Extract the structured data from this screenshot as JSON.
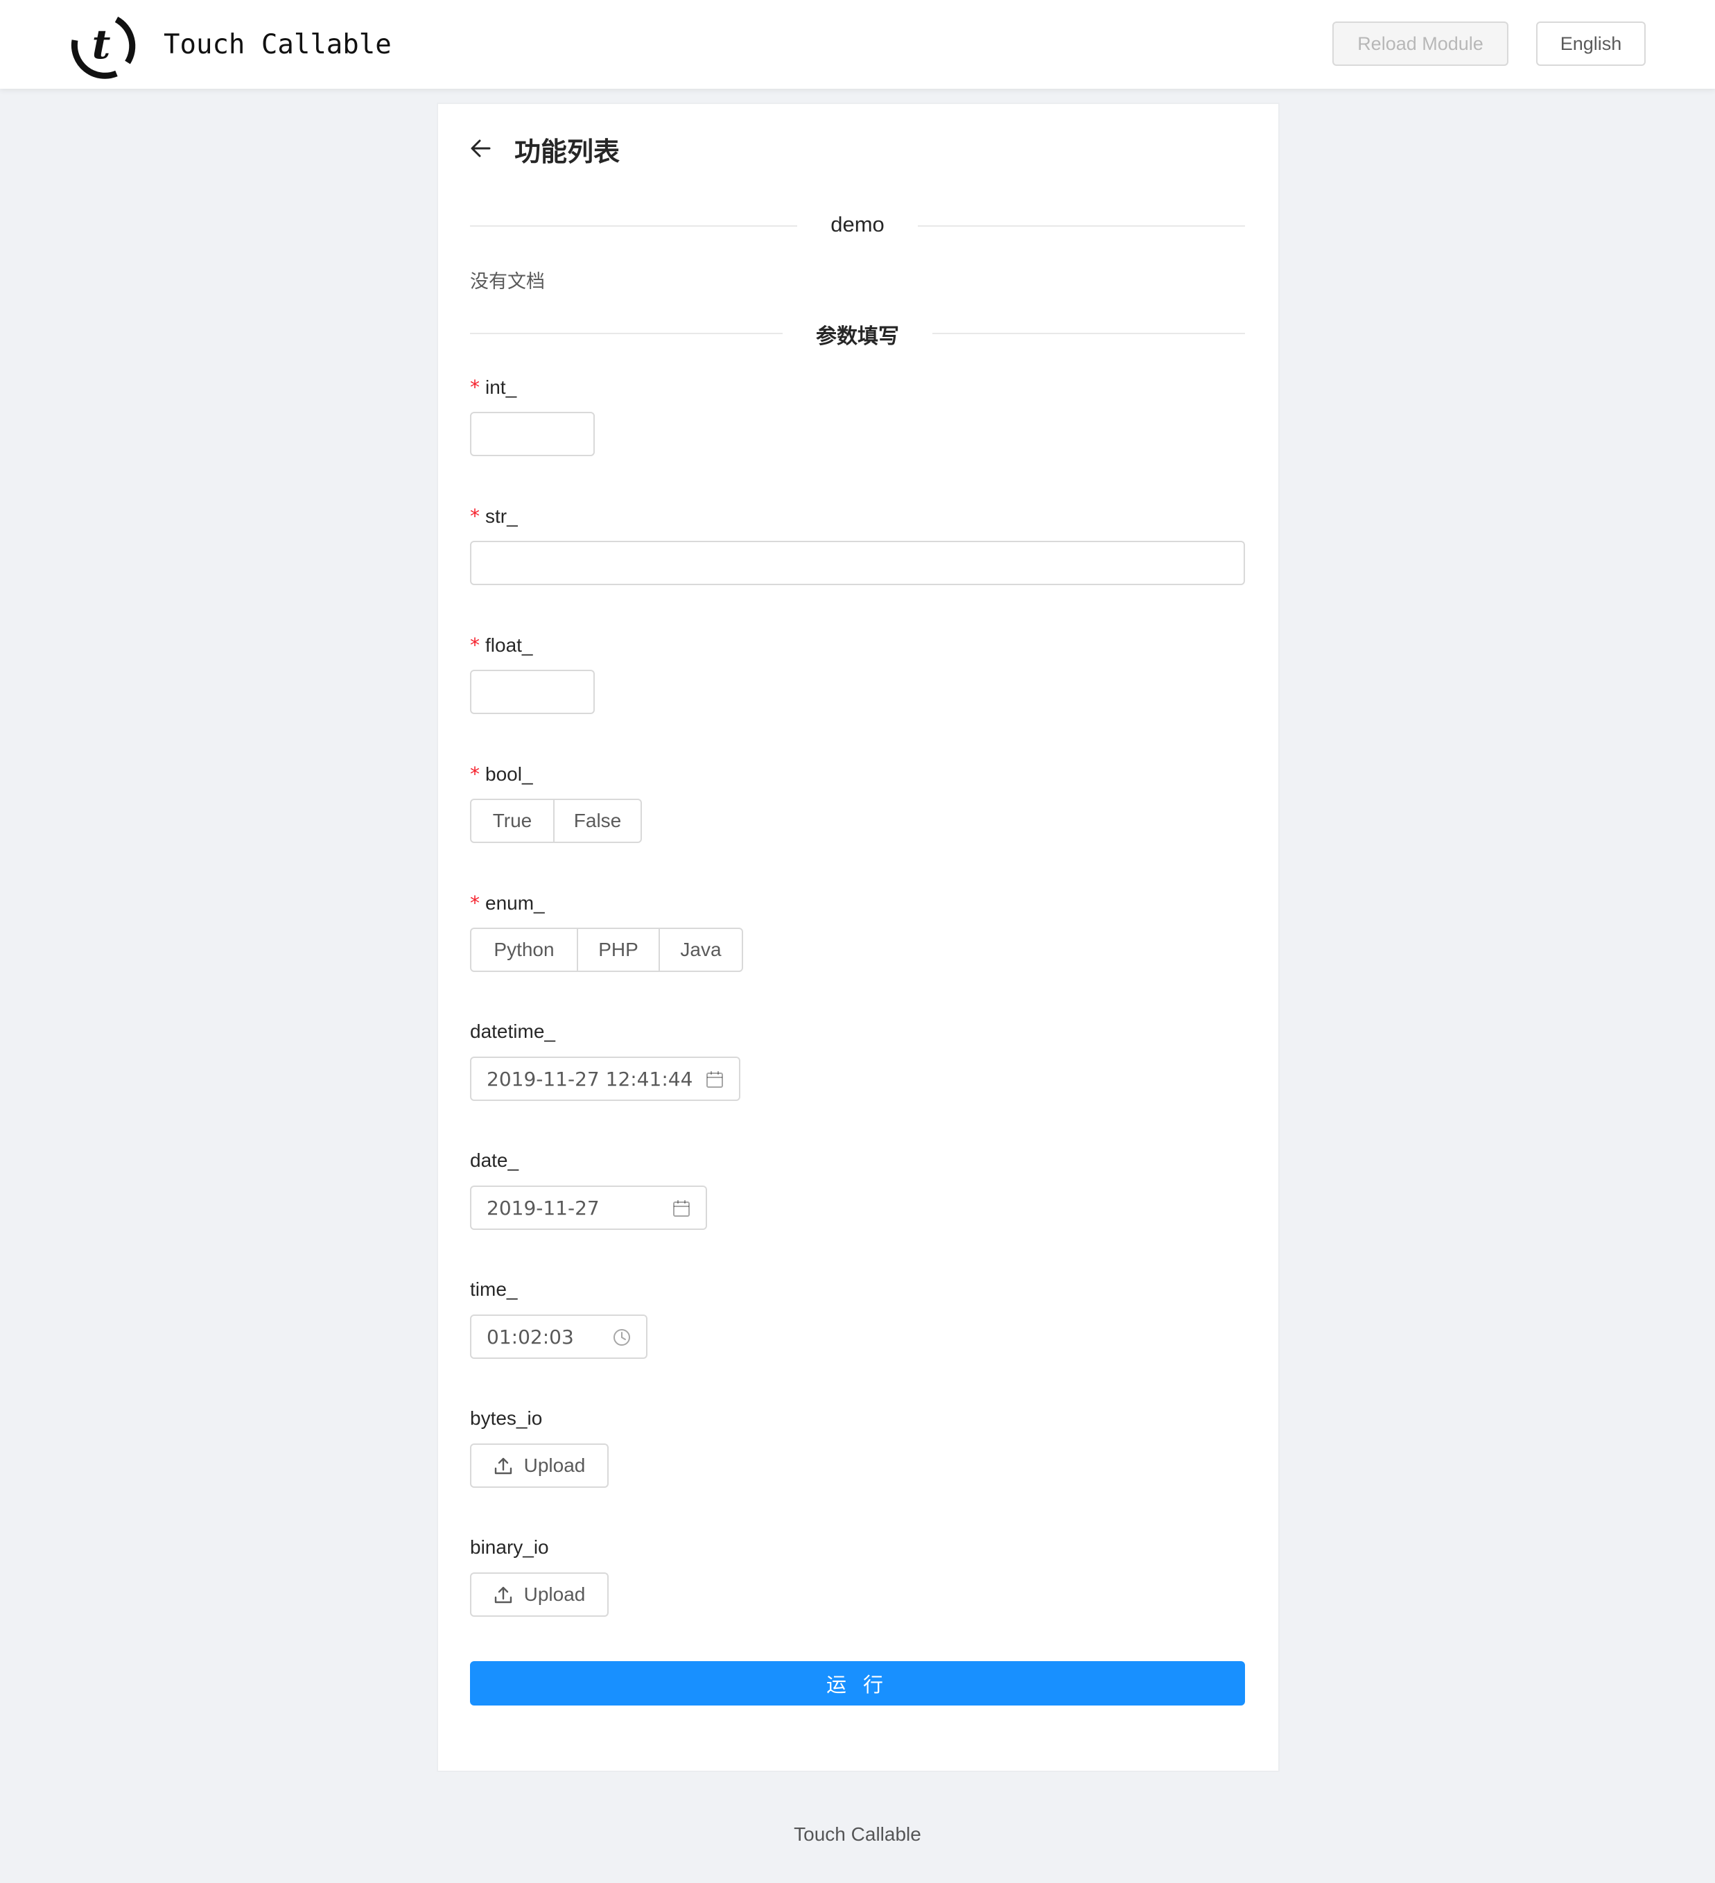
{
  "header": {
    "app_name": "Touch Callable",
    "reload_label": "Reload Module",
    "lang_label": "English",
    "logo_icon": "t-circle-logo-icon"
  },
  "page": {
    "title": "功能列表",
    "back_icon": "arrow-left-icon"
  },
  "function": {
    "name": "demo",
    "doc": "没有文档"
  },
  "params_section": "参数填写",
  "fields": {
    "int_": {
      "label": "int_",
      "required": true,
      "value": ""
    },
    "str_": {
      "label": "str_",
      "required": true,
      "value": ""
    },
    "float_": {
      "label": "float_",
      "required": true,
      "value": ""
    },
    "bool_": {
      "label": "bool_",
      "required": true,
      "options": [
        "True",
        "False"
      ]
    },
    "enum_": {
      "label": "enum_",
      "required": true,
      "options": [
        "Python",
        "PHP",
        "Java"
      ]
    },
    "datetime_": {
      "label": "datetime_",
      "value": "2019-11-27 12:41:44",
      "icon": "calendar-icon"
    },
    "date_": {
      "label": "date_",
      "value": "2019-11-27",
      "icon": "calendar-icon"
    },
    "time_": {
      "label": "time_",
      "value": "01:02:03",
      "icon": "clock-icon"
    },
    "bytes_io": {
      "label": "bytes_io",
      "button": "Upload",
      "icon": "upload-icon"
    },
    "binary_io": {
      "label": "binary_io",
      "button": "Upload",
      "icon": "upload-icon"
    }
  },
  "run_label": "运 行",
  "footer": {
    "text": "Touch Callable"
  },
  "colors": {
    "primary": "#1890ff",
    "required": "#f5222d",
    "background": "#f0f2f5"
  }
}
